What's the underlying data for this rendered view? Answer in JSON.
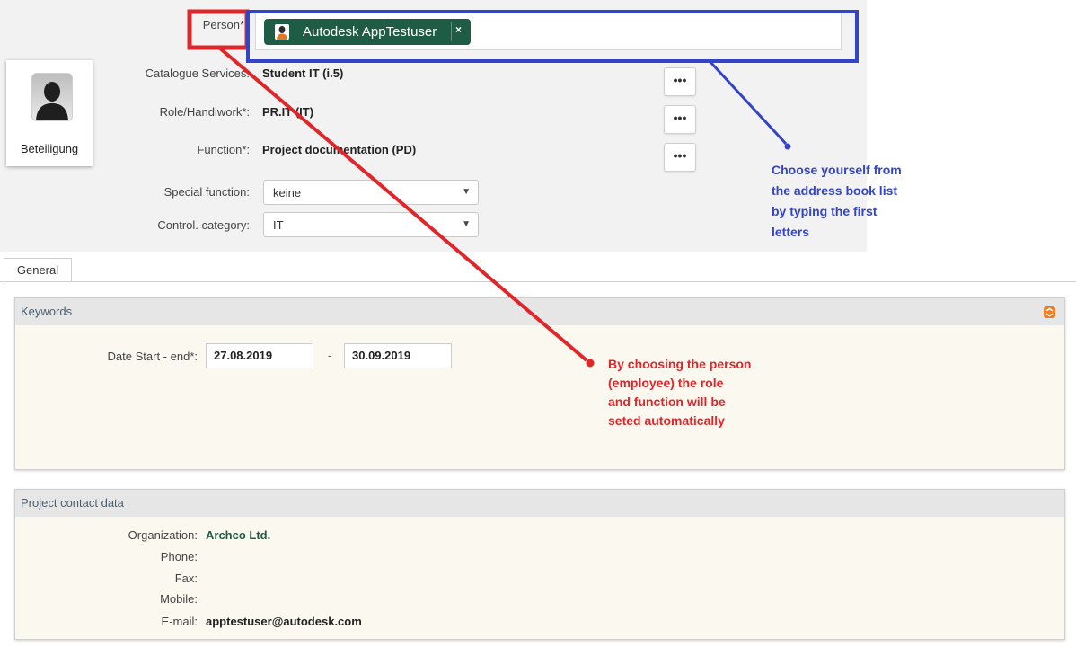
{
  "header": {
    "person_label": "Person*",
    "person_chip": "Autodesk AppTestuser",
    "chip_remove": "×",
    "avatar_caption": "Beteiligung",
    "fields": [
      {
        "label": "Catalogue Services:",
        "value": "Student IT (i.5)"
      },
      {
        "label": "Role/Handiwork*:",
        "value": "PR.IT (IT)"
      },
      {
        "label": "Function*:",
        "value": "Project documentation (PD)"
      }
    ],
    "dots_label": "•••",
    "special_function_label": "Special function:",
    "special_function_value": "keine",
    "control_category_label": "Control. category:",
    "control_category_value": "IT"
  },
  "tabs": [
    "General"
  ],
  "keywords": {
    "title": "Keywords",
    "date_label": "Date Start - end*:",
    "date_start": "27.08.2019",
    "date_sep": "-",
    "date_end": "30.09.2019"
  },
  "contact": {
    "title": "Project contact data",
    "rows": [
      {
        "label": "Organization:",
        "value": "Archco Ltd."
      },
      {
        "label": "Phone:",
        "value": ""
      },
      {
        "label": "Fax:",
        "value": ""
      },
      {
        "label": "Mobile:",
        "value": ""
      },
      {
        "label": "E-mail:",
        "value": "apptestuser@autodesk.com"
      }
    ]
  },
  "annotations": {
    "red_note": [
      "By choosing the person",
      "(employee) the role",
      "and function will be",
      "seted automatically"
    ],
    "blue_note": [
      "Choose yourself from",
      "the address book list",
      "by typing the first",
      "letters"
    ]
  },
  "colors": {
    "chip": "#1f5c45",
    "red_annotation": "#e0262b",
    "blue_annotation": "#3344c6",
    "panel_bg": "#fbf9ef",
    "org_link": "#1f5c45",
    "collapse_icon": "#f07d22"
  },
  "icons": {
    "chip_avatar": "person-icon",
    "chip_remove": "close-icon",
    "avatar": "person-silhouette-icon",
    "collapse": "collapse-icon",
    "dropdown": "chevron-down-icon"
  }
}
